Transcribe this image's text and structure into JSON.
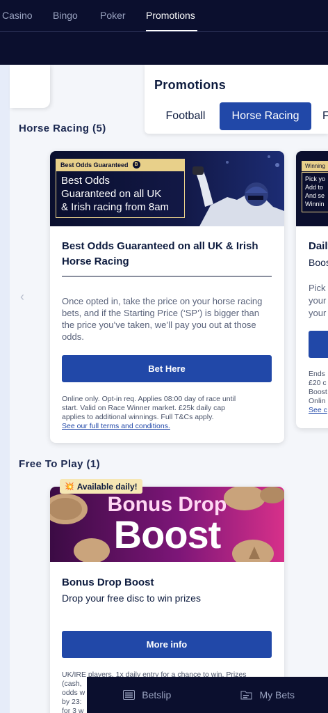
{
  "topnav": {
    "tabs": [
      {
        "label": "Casino",
        "active": false
      },
      {
        "label": "Bingo",
        "active": false
      },
      {
        "label": "Poker",
        "active": false
      },
      {
        "label": "Promotions",
        "active": true
      }
    ]
  },
  "promotions_panel": {
    "title": "Promotions",
    "filters": [
      {
        "label": "Football",
        "active": false
      },
      {
        "label": "Horse Racing",
        "active": true
      },
      {
        "label": "F",
        "active": false
      }
    ]
  },
  "sections": {
    "horse_racing": {
      "title": "Horse Racing (5)",
      "cards": [
        {
          "banner_tag": "Best Odds Guaranteed",
          "banner_badge": "B",
          "banner_text_lines": [
            "Best Odds",
            "Guaranteed on all UK",
            "& Irish racing from 8am"
          ],
          "title_lines": [
            "Best Odds Guaranteed on all UK & Irish",
            "Horse Racing"
          ],
          "description_lines": [
            "Once opted in, take the price on your horse racing",
            "bets, and if the Starting Price (‘SP’) is bigger than",
            "the price you’ve taken, we’ll pay you out at those",
            "odds."
          ],
          "cta": "Bet Here",
          "terms_lines": [
            "Online only. Opt-in req. Applies 08:00 day of race until",
            "start. Valid on Race Winner market. £25k daily cap",
            "applies to additional winnings. Full T&Cs apply."
          ],
          "terms_link": "See our full terms and conditions."
        },
        {
          "banner_tag": "Winning",
          "banner_text_lines": [
            "Pick yo",
            "Add to",
            "And se",
            "Winnin"
          ],
          "title": "Daily",
          "subtitle": "Boos",
          "description_lines": [
            "Pick",
            "your",
            "your"
          ],
          "terms_lines": [
            "Ends",
            "£20 c",
            "Boost",
            "Onlin"
          ],
          "terms_link": "See c"
        }
      ],
      "prev_arrow": "‹"
    },
    "free_to_play": {
      "title": "Free To Play (1)",
      "cards": [
        {
          "badge": "Available daily!",
          "badge_icon": "💥",
          "banner_line1": "Bonus Drop",
          "banner_line2": "Boost",
          "title": "Bonus Drop Boost",
          "subtitle": "Drop your free disc to win prizes",
          "cta": "More info",
          "terms_lines": [
            "UK/IRE players. 1x daily entry for a chance to win. Prizes",
            "(cash,",
            "odds w",
            "by 23:",
            "for 3 w"
          ]
        }
      ]
    }
  },
  "bottombar": {
    "items": [
      {
        "label": "Betslip",
        "icon": "betslip-icon"
      },
      {
        "label": "My Bets",
        "icon": "my-bets-icon"
      }
    ]
  },
  "colors": {
    "nav_bg": "#0b0f2e",
    "accent_blue": "#2148a8",
    "gold": "#e8d08a"
  }
}
